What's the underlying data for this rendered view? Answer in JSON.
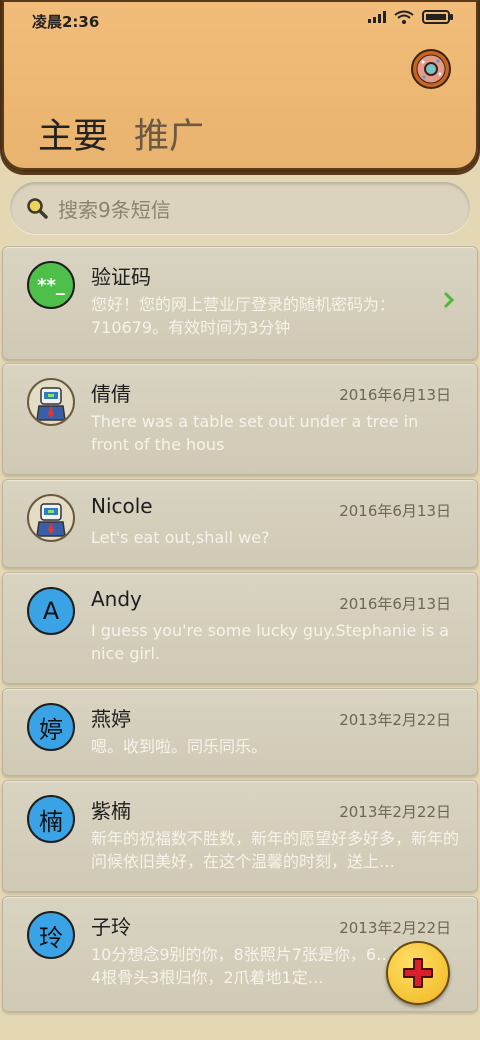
{
  "status_bar": {
    "time": "凌晨2:36",
    "icons": [
      "signal-icon",
      "wifi-icon",
      "battery-icon"
    ]
  },
  "header": {
    "tabs": [
      {
        "label": "主要",
        "selected": true
      },
      {
        "label": "推广",
        "selected": false
      }
    ],
    "profile_icon": "donut-icon"
  },
  "search": {
    "placeholder": "搜索9条短信",
    "icon": "search-icon"
  },
  "messages": [
    {
      "name": "验证码",
      "date": "",
      "preview": "您好！您的网上营业厅登录的随机密码为：710679。有效时间为3分钟",
      "avatar": "**_",
      "avatar_type": "code"
    },
    {
      "name": "倩倩",
      "date": "2016年6月13日",
      "preview": "There was a table set out under a tree in front of the hous",
      "avatar": "",
      "avatar_type": "robot"
    },
    {
      "name": "Nicole",
      "date": "2016年6月13日",
      "preview": "Let's eat out,shall we?",
      "avatar": "",
      "avatar_type": "robot"
    },
    {
      "name": "Andy",
      "date": "2016年6月13日",
      "preview": "I guess you're some lucky guy.Stephanie is a nice girl.",
      "avatar": "A",
      "avatar_type": "letter"
    },
    {
      "name": "燕婷",
      "date": "2013年2月22日",
      "preview": "嗯。收到啦。同乐同乐。",
      "avatar": "婷",
      "avatar_type": "letter"
    },
    {
      "name": "紫楠",
      "date": "2013年2月22日",
      "preview": "新年的祝福数不胜数，新年的愿望好多好多，新年的问候依旧美好，在这个温馨的时刻，送上…",
      "avatar": "楠",
      "avatar_type": "letter"
    },
    {
      "name": "子玲",
      "date": "2013年2月22日",
      "preview": "10分想念9别的你，8张照片7张是你，6…只像你，4根骨头3根归你，2爪着地1定…",
      "avatar": "玲",
      "avatar_type": "letter"
    }
  ],
  "fab": {
    "icon": "plus-icon"
  },
  "colors": {
    "header": "#edb874",
    "avatar_blue": "#3aa3e6",
    "avatar_green": "#4ec04a",
    "fab": "#f4c22a",
    "fab_plus": "#d8202a"
  }
}
